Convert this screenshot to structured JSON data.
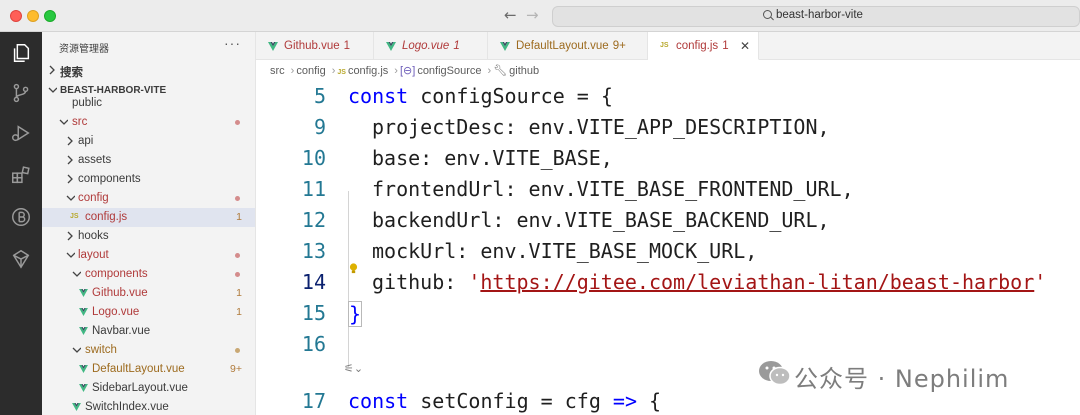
{
  "window": {
    "search_text": "beast-harbor-vite"
  },
  "sidebar": {
    "title": "资源管理器",
    "more": "···",
    "search_section": "搜索",
    "project": "BEAST-HARBOR-VITE",
    "items": [
      {
        "label": "public"
      },
      {
        "label": "src"
      },
      {
        "label": "api"
      },
      {
        "label": "assets"
      },
      {
        "label": "components"
      },
      {
        "label": "config"
      },
      {
        "label": "config.js",
        "badge": "1"
      },
      {
        "label": "hooks"
      },
      {
        "label": "layout"
      },
      {
        "label": "components"
      },
      {
        "label": "Github.vue",
        "badge": "1"
      },
      {
        "label": "Logo.vue",
        "badge": "1"
      },
      {
        "label": "Navbar.vue"
      },
      {
        "label": "switch"
      },
      {
        "label": "DefaultLayout.vue",
        "badge": "9+"
      },
      {
        "label": "SidebarLayout.vue"
      },
      {
        "label": "SwitchIndex.vue"
      }
    ]
  },
  "tabs": [
    {
      "label": "Github.vue",
      "count": "1"
    },
    {
      "label": "Logo.vue",
      "count": "1"
    },
    {
      "label": "DefaultLayout.vue",
      "count": "9+"
    },
    {
      "label": "config.js",
      "count": "1",
      "close": "✕"
    }
  ],
  "breadcrumb": [
    "src",
    "config",
    "config.js",
    "configSource",
    "github"
  ],
  "code": {
    "lines": [
      {
        "n": "5",
        "kw": "const",
        "text": " configSource = {"
      },
      {
        "n": "9",
        "text": "projectDesc: env.VITE_APP_DESCRIPTION,"
      },
      {
        "n": "10",
        "text": "base: env.VITE_BASE,"
      },
      {
        "n": "11",
        "text": "frontendUrl: env.VITE_BASE_FRONTEND_URL,"
      },
      {
        "n": "12",
        "text": "backendUrl: env.VITE_BASE_BACKEND_URL,"
      },
      {
        "n": "13",
        "text": "mockUrl: env.VITE_BASE_MOCK_URL,"
      },
      {
        "n": "14",
        "text": "github: ",
        "str_q1": "'",
        "str_url": "https://gitee.com/leviathan-litan/beast-harbor",
        "str_q2": "'"
      },
      {
        "n": "15",
        "text": "}"
      },
      {
        "n": "16",
        "text": ""
      },
      {
        "n": "17",
        "kw": "const",
        "text": " setConfig = cfg ",
        "arrow": "=>",
        "tail": " {"
      }
    ]
  },
  "watermark": {
    "text": "公众号 · Nephilim"
  },
  "colors": {
    "modified": "#b03a3a",
    "keyword": "#0000ff",
    "string": "#a31515",
    "line_number": "#237893"
  }
}
